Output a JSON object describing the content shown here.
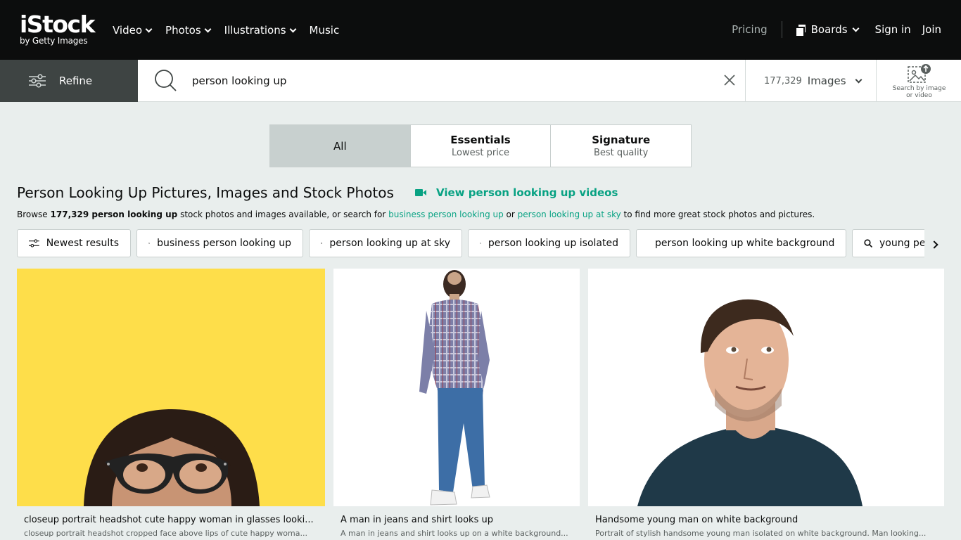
{
  "brand": {
    "logo": "iStock",
    "tagline": "by Getty Images"
  },
  "nav": {
    "items": [
      {
        "label": "Video"
      },
      {
        "label": "Photos"
      },
      {
        "label": "Illustrations"
      },
      {
        "label": "Music"
      }
    ],
    "pricing": "Pricing",
    "boards": "Boards",
    "signin": "Sign in",
    "join": "Join"
  },
  "search": {
    "refine_label": "Refine",
    "query": "person looking up",
    "result_count": "177,329",
    "media_type": "Images",
    "visual_search_label_1": "Search by image",
    "visual_search_label_2": "or video"
  },
  "toggle": {
    "options": [
      {
        "title": "All",
        "subtitle": "",
        "active": true
      },
      {
        "title": "Essentials",
        "subtitle": "Lowest price",
        "active": false
      },
      {
        "title": "Signature",
        "subtitle": "Best quality",
        "active": false
      }
    ]
  },
  "heading": {
    "title": "Person Looking Up Pictures, Images and Stock Photos",
    "videos_link": "View person looking up videos"
  },
  "browse": {
    "p1": "Browse ",
    "count": "177,329",
    "term": " person looking up",
    "p2": " stock photos and images available, or search for ",
    "link1": "business person looking up",
    "p3": " or ",
    "link2": "person looking up at sky",
    "p4": " to find more great stock photos and pictures."
  },
  "chips": [
    {
      "label": "Newest results",
      "icon": "sliders-icon"
    },
    {
      "label": "business person looking up",
      "icon": "search-icon"
    },
    {
      "label": "person looking up at sky",
      "icon": "search-icon"
    },
    {
      "label": "person looking up isolated",
      "icon": "search-icon"
    },
    {
      "label": "person looking up white background",
      "icon": "search-icon"
    },
    {
      "label": "young person looking up",
      "icon": "search-icon"
    }
  ],
  "results": [
    {
      "title": "closeup portrait headshot cute happy woman in glasses looki...",
      "description": "closeup portrait headshot cropped face above lips of cute happy woma..."
    },
    {
      "title": "A man in jeans and shirt looks up",
      "description": "A man in jeans and shirt looks up on a white background..."
    },
    {
      "title": "Handsome young man on white background",
      "description": "Portrait of stylish handsome young man isolated on white background. Man looking..."
    }
  ],
  "colors": {
    "accent": "#08a283",
    "nav_bg": "#0c0d0d",
    "page_bg": "#e9eeed",
    "refine_bg": "#3e4443",
    "yellow": "#fede4a"
  }
}
